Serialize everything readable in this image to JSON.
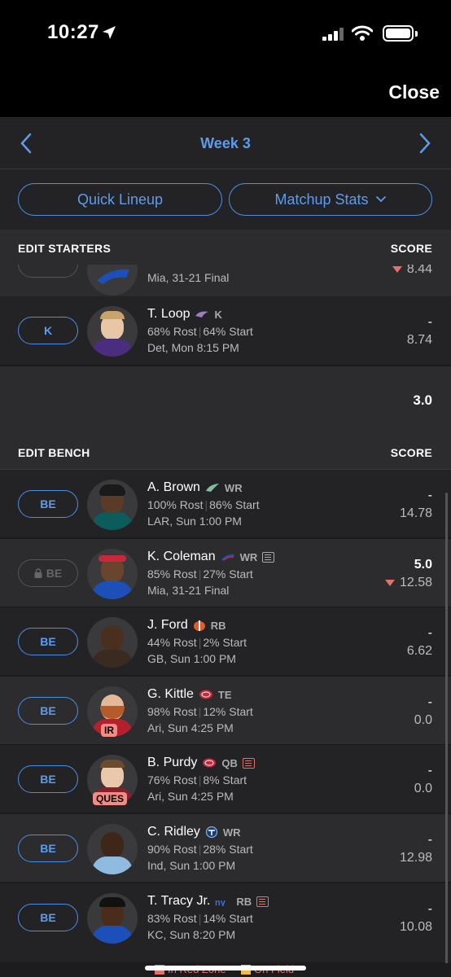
{
  "status_bar": {
    "time": "10:27"
  },
  "header": {
    "close_label": "Close"
  },
  "week_nav": {
    "label": "Week 3"
  },
  "actions": {
    "quick_lineup": "Quick Lineup",
    "matchup_stats": "Matchup Stats"
  },
  "starters": {
    "title": "EDIT STARTERS",
    "score_label": "SCORE",
    "partial_row": {
      "game": "Mia, 31-21 Final",
      "projected": "8.44"
    },
    "rows": [
      {
        "slot": "K",
        "name": "T. Loop",
        "pos": "K",
        "rost": "68% Rost",
        "start": "64% Start",
        "game": "Det, Mon 8:15 PM",
        "points": "-",
        "projected": "8.74"
      }
    ],
    "total": "3.0"
  },
  "bench": {
    "title": "EDIT BENCH",
    "score_label": "SCORE",
    "rows": [
      {
        "slot": "BE",
        "name": "A. Brown",
        "pos": "WR",
        "rost": "100% Rost",
        "start": "86% Start",
        "game": "LAR, Sun 1:00 PM",
        "points": "-",
        "projected": "14.78"
      },
      {
        "slot": "BE",
        "name": "K. Coleman",
        "pos": "WR",
        "rost": "85% Rost",
        "start": "27% Start",
        "game": "Mia, 31-21 Final",
        "points": "5.0",
        "projected": "12.58"
      },
      {
        "slot": "BE",
        "name": "J. Ford",
        "pos": "RB",
        "rost": "44% Rost",
        "start": "2% Start",
        "game": "GB, Sun 1:00 PM",
        "points": "-",
        "projected": "6.62"
      },
      {
        "slot": "BE",
        "name": "G. Kittle",
        "pos": "TE",
        "rost": "98% Rost",
        "start": "12% Start",
        "game": "Ari, Sun 4:25 PM",
        "points": "-",
        "projected": "0.0",
        "status": "IR"
      },
      {
        "slot": "BE",
        "name": "B. Purdy",
        "pos": "QB",
        "rost": "76% Rost",
        "start": "8% Start",
        "game": "Ari, Sun 4:25 PM",
        "points": "-",
        "projected": "0.0",
        "status": "QUES"
      },
      {
        "slot": "BE",
        "name": "C. Ridley",
        "pos": "WR",
        "rost": "90% Rost",
        "start": "28% Start",
        "game": "Ind, Sun 1:00 PM",
        "points": "-",
        "projected": "12.98"
      },
      {
        "slot": "BE",
        "name": "T. Tracy Jr.",
        "pos": "RB",
        "rost": "83% Rost",
        "start": "14% Start",
        "game": "KC, Sun 8:20 PM",
        "points": "-",
        "projected": "10.08"
      }
    ]
  },
  "legend": {
    "red_zone": "In Red Zone",
    "on_field": "On Field"
  },
  "colors": {
    "accent": "#5d9cec",
    "down": "#e2706b",
    "red_zone": "#e2706b",
    "on_field": "#f5b942"
  },
  "icons": {
    "loc": "location-arrow-icon",
    "prev": "chevron-left-icon",
    "next": "chevron-right-icon",
    "lock": "lock-icon",
    "news": "news-icon"
  }
}
